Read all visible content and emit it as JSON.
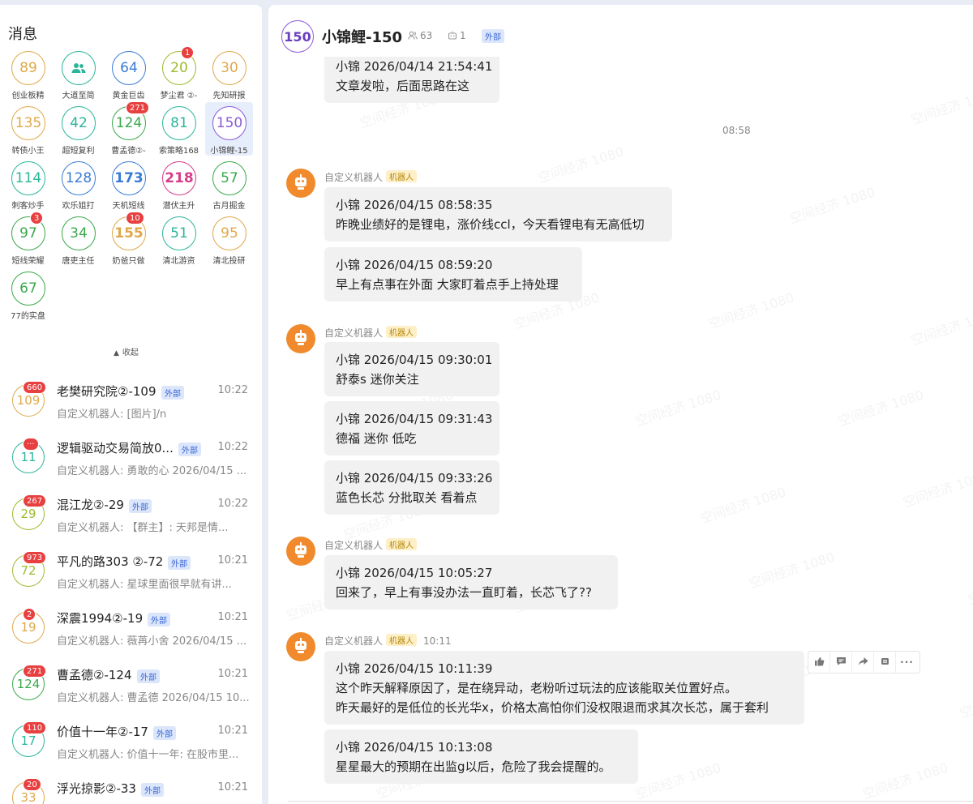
{
  "left": {
    "title": "消息",
    "collapse_label": "收起",
    "grid": [
      {
        "num": "89",
        "label": "创业板精",
        "color": "#e0a84a"
      },
      {
        "num": "",
        "label": "大道至简",
        "color": "#2bb59a",
        "icon": "people-icon"
      },
      {
        "num": "64",
        "label": "黄金巨齿",
        "color": "#3a7bd5"
      },
      {
        "num": "20",
        "label": "梦尘君 ②-",
        "color": "#9bbb2e",
        "badge": "1"
      },
      {
        "num": "30",
        "label": "先知研报",
        "color": "#e0a84a"
      },
      {
        "num": "135",
        "label": "转债小王",
        "color": "#e0a84a"
      },
      {
        "num": "42",
        "label": "超短复利",
        "color": "#2bb59a"
      },
      {
        "num": "124",
        "label": "曹孟德②-",
        "color": "#3aa84a",
        "badge": "271"
      },
      {
        "num": "81",
        "label": "索策略168",
        "color": "#2bb59a"
      },
      {
        "num": "150",
        "label": "小锦鲤-15",
        "color": "#8b5bd6",
        "selected": true
      },
      {
        "num": "114",
        "label": "刺客炒手",
        "color": "#2bb59a"
      },
      {
        "num": "128",
        "label": "欢乐姐打",
        "color": "#3a7bd5"
      },
      {
        "num": "173",
        "label": "天机短线",
        "color": "#3a7bd5",
        "bold": true
      },
      {
        "num": "218",
        "label": "潜伏主升",
        "color": "#d63c8a",
        "bold": true
      },
      {
        "num": "57",
        "label": "古月掘金",
        "color": "#3aa84a"
      },
      {
        "num": "97",
        "label": "短线荣耀",
        "color": "#3aa84a",
        "badge": "3"
      },
      {
        "num": "34",
        "label": "唐吏主任",
        "color": "#3aa84a"
      },
      {
        "num": "155",
        "label": "奶爸只做",
        "color": "#e0a84a",
        "badge": "10",
        "bold": true
      },
      {
        "num": "51",
        "label": "清北游资",
        "color": "#2bb59a"
      },
      {
        "num": "95",
        "label": "清北投研",
        "color": "#e0a84a"
      },
      {
        "num": "67",
        "label": "77的实盘",
        "color": "#3aa84a"
      }
    ],
    "conversations": [
      {
        "avatar": "109",
        "badge": "660",
        "color": "#e0a84a",
        "name": "老樊研究院②-109",
        "ext": "外部",
        "time": "10:22",
        "preview": "自定义机器人: [图片]/n"
      },
      {
        "avatar": "11",
        "badge": "···",
        "color": "#2bb59a",
        "name": "逻辑驱动交易简放0...",
        "ext": "外部",
        "time": "10:22",
        "preview": "自定义机器人: 勇敢的心 2026/04/15 ..."
      },
      {
        "avatar": "29",
        "badge": "267",
        "color": "#9bbb2e",
        "name": "混江龙②-29",
        "ext": "外部",
        "time": "10:22",
        "preview": "自定义机器人: 【群主】: 天邦是情..."
      },
      {
        "avatar": "72",
        "badge": "973",
        "color": "#9bbb2e",
        "name": "平凡的路303 ②-72",
        "ext": "外部",
        "time": "10:21",
        "preview": "自定义机器人: 星球里面很早就有讲..."
      },
      {
        "avatar": "19",
        "badge": "2",
        "color": "#e0a84a",
        "name": "深震1994②-19",
        "ext": "外部",
        "time": "10:21",
        "preview": "自定义机器人: 薇苒小舍 2026/04/15 ..."
      },
      {
        "avatar": "124",
        "badge": "271",
        "color": "#3aa84a",
        "name": "曹孟德②-124",
        "ext": "外部",
        "time": "10:21",
        "preview": "自定义机器人: 曹孟德 2026/04/15 10..."
      },
      {
        "avatar": "17",
        "badge": "110",
        "color": "#2bb59a",
        "name": "价值十一年②-17",
        "ext": "外部",
        "time": "10:21",
        "preview": "自定义机器人: 价值十一年: 在股市里..."
      },
      {
        "avatar": "33",
        "badge": "20",
        "color": "#e0a84a",
        "name": "浮光掠影②-33",
        "ext": "外部",
        "time": "10:21",
        "preview": ""
      }
    ]
  },
  "header": {
    "avatar": "150",
    "name": "小锦鲤-150",
    "members": "63",
    "bots": "1",
    "ext": "外部"
  },
  "chat": {
    "sender_name": "自定义机器人",
    "bot_tag": "机器人",
    "partial_bubble": {
      "line1": "小锦 2026/04/14 21:54:41",
      "line2": "文章发啦，后面思路在这"
    },
    "time_divider": "08:58",
    "watermark": "空间经济 1080",
    "groups": [
      {
        "time": "",
        "messages": [
          [
            "小锦 2026/04/15 08:58:35",
            "昨晚业绩好的是锂电，涨价线ccl，今天看锂电有无高低切"
          ],
          [
            "小锦 2026/04/15 08:59:20",
            "早上有点事在外面 大家盯着点手上持处理"
          ]
        ]
      },
      {
        "time": "",
        "messages": [
          [
            "小锦 2026/04/15 09:30:01",
            "舒泰s 迷你关注"
          ],
          [
            "小锦 2026/04/15 09:31:43",
            "德福 迷你 低吃"
          ],
          [
            "小锦 2026/04/15 09:33:26",
            "蓝色长芯 分批取关 看着点"
          ]
        ]
      },
      {
        "time": "",
        "messages": [
          [
            "小锦 2026/04/15 10:05:27",
            "回来了，早上有事没办法一直盯着，长芯飞了??"
          ]
        ]
      },
      {
        "time": "10:11",
        "messages": [
          [
            "小锦 2026/04/15 10:11:39",
            "这个昨天解释原因了，是在绕异动，老粉听过玩法的应该能取关位置好点。",
            "昨天最好的是低位的长光华x，价格太高怕你们没权限退而求其次长芯，属于套利"
          ],
          [
            "小锦 2026/04/15 10:13:08",
            "星星最大的预期在出监g以后，危险了我会提醒的。"
          ]
        ]
      }
    ]
  }
}
